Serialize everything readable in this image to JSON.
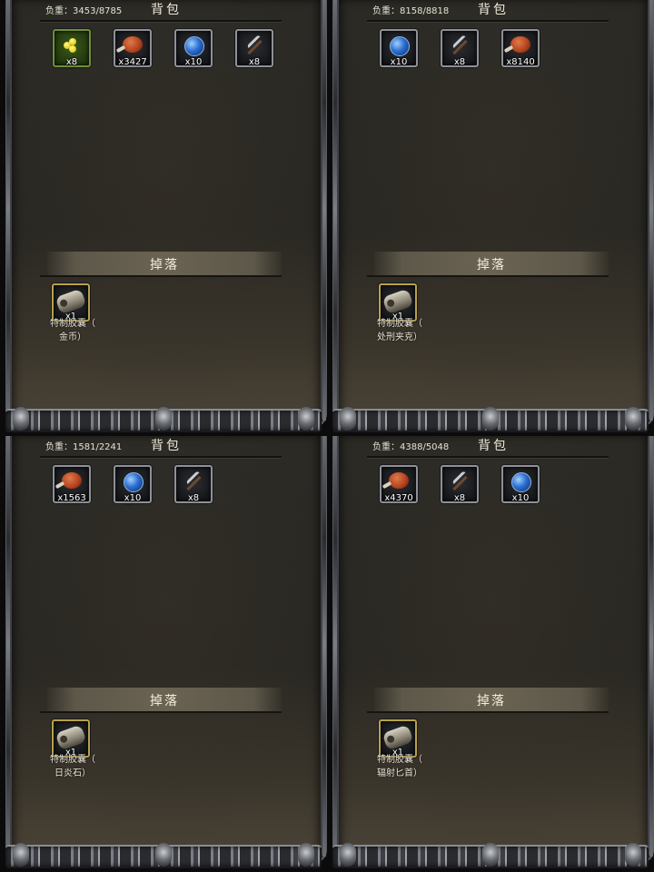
{
  "panels": [
    {
      "weight": "负重：3453/8785",
      "bag_title": "背包",
      "items": [
        {
          "type": "gold",
          "count": "x8",
          "name": "大金块"
        },
        {
          "type": "food",
          "count": "x3427",
          "name": "食物"
        },
        {
          "type": "lens",
          "count": "x10",
          "name": "透镜"
        },
        {
          "type": "pick",
          "count": "x8",
          "name": "十字镐"
        }
      ],
      "drop_title": "掉落",
      "drop": {
        "count": "x1",
        "name_line1": "特制胶囊（",
        "name_line2": "金币）"
      }
    },
    {
      "weight": "负重：8158/8818",
      "bag_title": "背包",
      "items": [
        {
          "type": "lens",
          "count": "x10",
          "name": "透镜"
        },
        {
          "type": "pick",
          "count": "x8",
          "name": "十字镐"
        },
        {
          "type": "food",
          "count": "x8140",
          "name": "食物"
        }
      ],
      "drop_title": "掉落",
      "drop": {
        "count": "x1",
        "name_line1": "特制胶囊（",
        "name_line2": "处刑夹克）"
      }
    },
    {
      "weight": "负重：1581/2241",
      "bag_title": "背包",
      "items": [
        {
          "type": "food",
          "count": "x1563",
          "name": "食物"
        },
        {
          "type": "lens",
          "count": "x10",
          "name": "透镜"
        },
        {
          "type": "pick",
          "count": "x8",
          "name": "十字镐"
        }
      ],
      "drop_title": "掉落",
      "drop": {
        "count": "x1",
        "name_line1": "特制胶囊（",
        "name_line2": "日炎石）"
      }
    },
    {
      "weight": "负重：4388/5048",
      "bag_title": "背包",
      "items": [
        {
          "type": "food",
          "count": "x4370",
          "name": "食物"
        },
        {
          "type": "pick",
          "count": "x8",
          "name": "十字镐"
        },
        {
          "type": "lens",
          "count": "x10",
          "name": "透镜"
        }
      ],
      "drop_title": "掉落",
      "drop": {
        "count": "x1",
        "name_line1": "特制胶囊（",
        "name_line2": "辐射匕首）"
      }
    }
  ]
}
